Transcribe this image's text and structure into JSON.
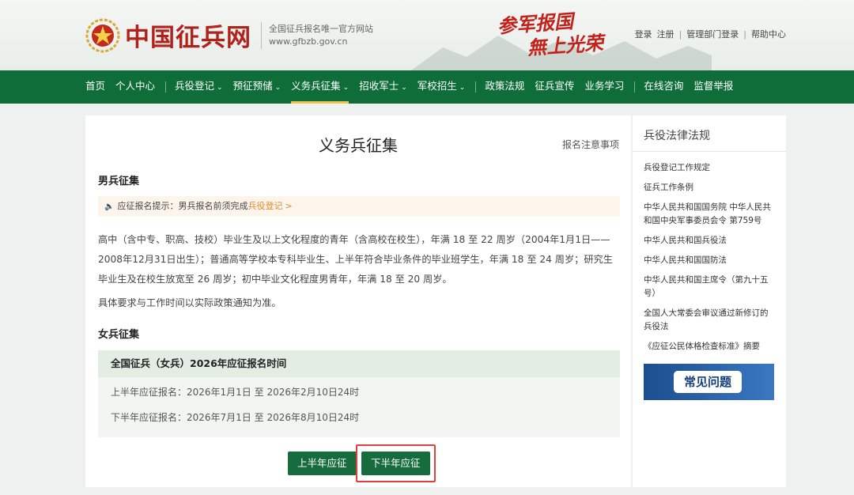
{
  "header": {
    "site_name": "中国征兵网",
    "subtitle": "全国征兵报名唯一官方网站",
    "url": "www.gfbzb.gov.cn",
    "slogan_line1": "参军报国",
    "slogan_line2": "無上光荣",
    "links": [
      "登录",
      "注册",
      "管理部门登录",
      "帮助中心"
    ]
  },
  "nav": {
    "items": [
      "首页",
      "个人中心",
      "兵役登记",
      "预征预储",
      "义务兵征集",
      "招收军士",
      "军校招生",
      "政策法规",
      "征兵宣传",
      "业务学习",
      "在线咨询",
      "监督举报"
    ],
    "active": "义务兵征集"
  },
  "main": {
    "title": "义务兵征集",
    "notice_link": "报名注意事项",
    "male_heading": "男兵征集",
    "tip_prefix": "应征报名提示：男兵报名前须完成",
    "tip_link": "兵役登记",
    "tip_arrow": ">",
    "male_para": "高中（含中专、职高、技校）毕业生及以上文化程度的青年（含高校在校生），年满 18 至 22 周岁（2004年1月1日——2008年12月31日出生）；普通高等学校本专科毕业生、上半年符合毕业条件的毕业班学生，年满 18 至 24 周岁；研究生毕业生及在校生放宽至 26 周岁；初中毕业文化程度男青年，年满 18 至 20 周岁。",
    "male_note": "具体要求与工作时间以实际政策通知为准。",
    "female_heading": "女兵征集",
    "female_table": {
      "header": "全国征兵（女兵）2026年应征报名时间",
      "rows": [
        "上半年应征报名：2026年1月1日 至 2026年2月10日24时",
        "下半年应征报名：2026年7月1日 至 2026年8月10日24时"
      ]
    },
    "btn_first_half": "上半年应征",
    "btn_second_half": "下半年应征"
  },
  "sidebar": {
    "title": "兵役法律法规",
    "items": [
      "兵役登记工作规定",
      "征兵工作条例",
      "中华人民共和国国务院 中华人民共和国中央军事委员会令 第759号",
      "中华人民共和国兵役法",
      "中华人民共和国国防法",
      "中华人民共和国主席令（第九十五号）",
      "全国人大常委会审议通过新修订的兵役法",
      "《应征公民体格检查标准》摘要"
    ],
    "faq_label": "常见问题"
  },
  "colors": {
    "nav_green": "#0f6d3a",
    "brand_red": "#b1221c",
    "button_green": "#176c3d",
    "highlight_red": "#e0403d",
    "tip_orange": "#e08a2a"
  },
  "icons": [
    "army-emblem-icon",
    "speaker-icon",
    "chevron-down-icon"
  ]
}
